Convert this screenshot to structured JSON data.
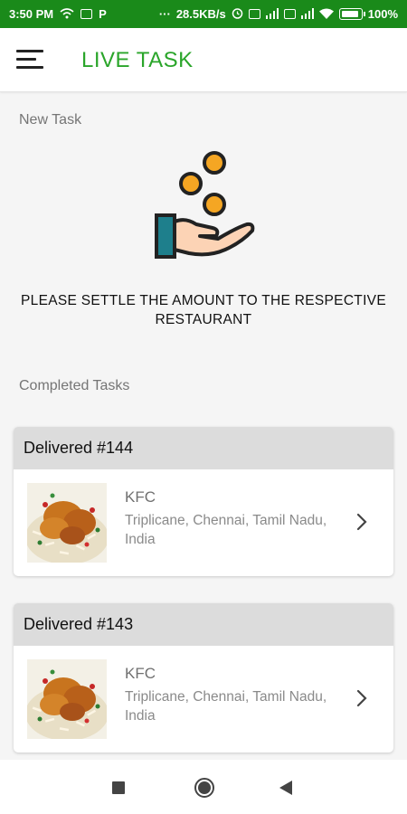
{
  "status_bar": {
    "time": "3:50 PM",
    "p_label": "P",
    "dots": "···",
    "speed": "28.5KB/s",
    "battery": "100%"
  },
  "app_bar": {
    "title": "LIVE TASK",
    "icon": "menu-icon"
  },
  "new_task": {
    "section_label": "New Task",
    "icon": "hand-coins-icon",
    "message": "PLEASE SETTLE THE AMOUNT TO THE RESPECTIVE RESTAURANT"
  },
  "completed": {
    "section_label": "Completed Tasks",
    "tasks": [
      {
        "title": "Delivered #144",
        "store": "KFC",
        "address": "Triplicane, Chennai, Tamil Nadu, India"
      },
      {
        "title": "Delivered #143",
        "store": "KFC",
        "address": "Triplicane, Chennai, Tamil Nadu, India"
      }
    ]
  },
  "colors": {
    "accent": "#2aa52a",
    "status_bar": "#1a8a1a",
    "card_header": "#dcdcdc"
  }
}
